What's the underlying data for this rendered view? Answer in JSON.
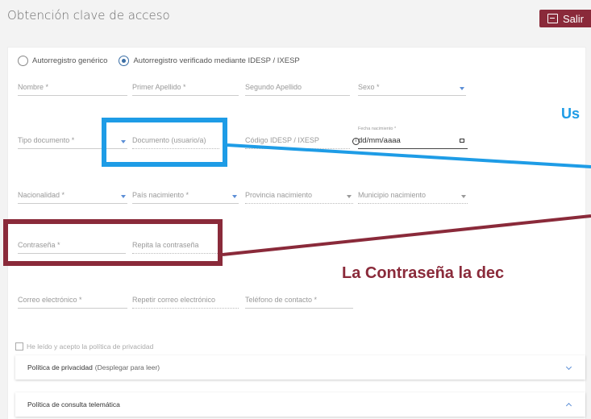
{
  "header": {
    "title": "Obtención clave de acceso",
    "exit_label": "Salir"
  },
  "form": {
    "radio_options": [
      {
        "label": "Autorregistro genérico",
        "selected": false
      },
      {
        "label": "Autorregistro verificado mediante IDESP / IXESP",
        "selected": true
      }
    ],
    "fields": {
      "nombre": "Nombre *",
      "primer_apellido": "Primer Apellido *",
      "segundo_apellido": "Segundo Apellido",
      "sexo": "Sexo *",
      "tipo_documento": "Tipo documento *",
      "documento": "Documento (usuario/a)",
      "codigo_idesp": "Código IDESP / IXESP",
      "fecha_nacimiento_label": "Fecha nacimiento *",
      "fecha_nacimiento_value": "dd/mm/aaaa",
      "nacionalidad": "Nacionalidad *",
      "pais_nacimiento": "País nacimiento *",
      "provincia_nacimiento": "Provincia nacimiento",
      "municipio_nacimiento": "Municipio nacimiento",
      "contrasena": "Contraseña *",
      "repita_contrasena": "Repita la contraseña",
      "correo": "Correo electrónico *",
      "repetir_correo": "Repetir correo electrónico",
      "telefono": "Teléfono de contacto *"
    },
    "privacy_check": "He leído y acepto la política de privacidad",
    "panels": {
      "privacy_title": "Política de privacidad",
      "privacy_hint": "(Desplegar para leer)",
      "telematic_title": "Política de consulta telemática"
    }
  },
  "annotations": {
    "blue_note": "Us",
    "red_note": "La Contraseña la dec"
  },
  "colors": {
    "accent_red": "#8a2a3a",
    "highlight_blue": "#1e9ce6",
    "link_blue": "#3a6ea5"
  }
}
